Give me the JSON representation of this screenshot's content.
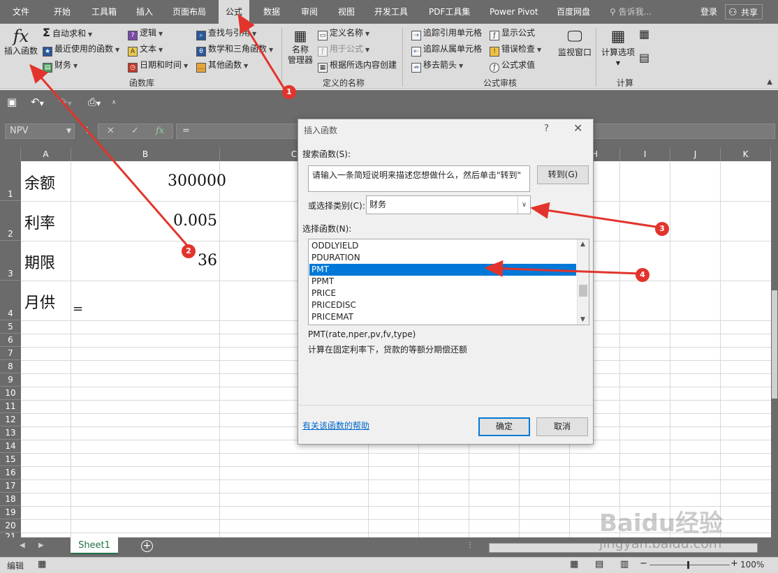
{
  "menu": {
    "tabs": [
      {
        "label": "文件"
      },
      {
        "label": "开始"
      },
      {
        "label": "工具箱"
      },
      {
        "label": "插入"
      },
      {
        "label": "页面布局"
      },
      {
        "label": "公式"
      },
      {
        "label": "数据"
      },
      {
        "label": "审阅"
      },
      {
        "label": "视图"
      },
      {
        "label": "开发工具"
      },
      {
        "label": "PDF工具集"
      },
      {
        "label": "Power Pivot"
      },
      {
        "label": "百度网盘"
      }
    ],
    "active_tab": "公式",
    "tell_me": "告诉我...",
    "login": "登录",
    "share": "共享"
  },
  "ribbon": {
    "insert_function": "插入函数",
    "autosum": "自动求和",
    "recent": "最近使用的函数",
    "financial": "财务",
    "logical": "逻辑",
    "text": "文本",
    "datetime": "日期和时间",
    "lookup": "查找与引用",
    "math": "数学和三角函数",
    "more": "其他函数",
    "library_label": "函数库",
    "name_manager": "名称\n管理器",
    "define_name": "定义名称",
    "use_in_formula": "用于公式",
    "create_from_selection": "根据所选内容创建",
    "defined_names_label": "定义的名称",
    "trace_precedents": "追踪引用单元格",
    "trace_dependents": "追踪从属单元格",
    "remove_arrows": "移去箭头",
    "show_formulas": "显示公式",
    "error_checking": "错误检查",
    "evaluate_formula": "公式求值",
    "auditing_label": "公式审核",
    "watch_window": "监视窗口",
    "calc_options": "计算选项",
    "calc_label": "计算"
  },
  "formula_bar": {
    "name_box": "NPV",
    "cancel": "✕",
    "enter": "✓",
    "fx": "fx",
    "content": "="
  },
  "grid": {
    "columns": [
      "A",
      "B",
      "C",
      "D",
      "E",
      "F",
      "G",
      "H",
      "I",
      "J",
      "K"
    ],
    "rows": [
      "1",
      "2",
      "3",
      "4",
      "5",
      "6",
      "7",
      "8",
      "9",
      "10",
      "11",
      "12",
      "13",
      "14",
      "15",
      "16",
      "17",
      "18",
      "19",
      "20",
      "21"
    ],
    "cells": [
      {
        "label": "余额",
        "value": "300000"
      },
      {
        "label": "利率",
        "value": "0.005"
      },
      {
        "label": "期限",
        "value": "36"
      },
      {
        "label": "月供",
        "value": "="
      }
    ]
  },
  "sheet_tabs": {
    "active": "Sheet1"
  },
  "status": {
    "mode": "编辑",
    "zoom": "100%"
  },
  "dialog": {
    "title": "插入函数",
    "help": "?",
    "close": "✕",
    "search_label": "搜索函数(S):",
    "search_value": "请输入一条简短说明来描述您想做什么，然后单击\"转到\"",
    "go_button": "转到(G)",
    "category_label": "或选择类别(C):",
    "category_value": "财务",
    "select_label": "选择函数(N):",
    "functions": [
      "ODDLYIELD",
      "PDURATION",
      "PMT",
      "PPMT",
      "PRICE",
      "PRICEDISC",
      "PRICEMAT"
    ],
    "selected_function": "PMT",
    "signature": "PMT(rate,nper,pv,fv,type)",
    "description": "计算在固定利率下，贷款的等额分期偿还额",
    "help_link": "有关该函数的帮助",
    "ok": "确定",
    "cancel": "取消"
  },
  "annotations": {
    "badges": [
      "1",
      "2",
      "3",
      "4"
    ],
    "color": "#e2342c"
  },
  "watermark": {
    "logo": "Baidu经验",
    "url": "jingyan.baidu.com"
  }
}
